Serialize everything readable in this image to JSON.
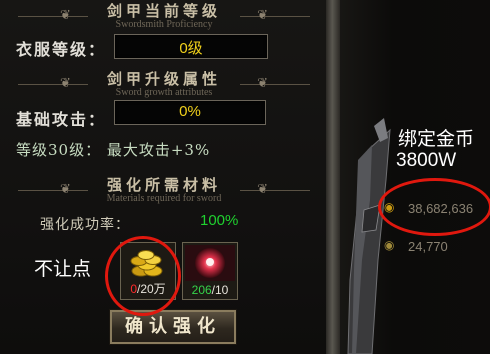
{
  "sections": {
    "proficiency": {
      "title": "剑甲当前等级",
      "subtitle": "Swordsmith Proficiency"
    },
    "growth": {
      "title": "剑甲升级属性",
      "subtitle": "Sword growth attributes"
    },
    "materials": {
      "title": "强化所需材料",
      "subtitle": "Materials required for sword"
    }
  },
  "clothing_level": {
    "label": "衣服等级：",
    "value": "0级"
  },
  "base_attack": {
    "label": "基础攻击：",
    "value": "0%"
  },
  "level_bonus": "等级30级： 最大攻击+3%",
  "success_rate": {
    "label": "强化成功率：",
    "value": "100%"
  },
  "material_slots": [
    {
      "have": "0",
      "need": "/20万",
      "have_color": "#ff2a2a"
    },
    {
      "have": "206",
      "need": "/10",
      "have_color": "#35d24a"
    }
  ],
  "confirm_button": "确认强化",
  "currency": {
    "bound_gold": "38,682,636",
    "other": "24,770"
  },
  "annotations": {
    "bound_gold_label": "绑定金币",
    "bound_gold_amount": "3800W",
    "no_give": "不让点"
  },
  "colors": {
    "yellow_value": "#f2d21b",
    "success_green": "#1fd12f",
    "annotation_red": "#e0180e"
  }
}
